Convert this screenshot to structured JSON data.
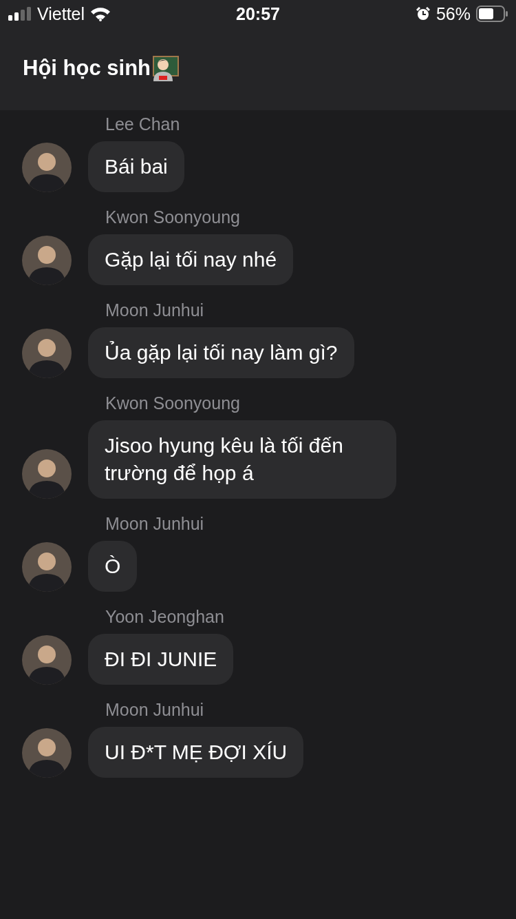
{
  "status_bar": {
    "carrier": "Viettel",
    "time": "20:57",
    "battery": "56%"
  },
  "header": {
    "title": "Hội học sinh"
  },
  "messages": [
    {
      "sender": "Lee Chan",
      "text": "Bái bai"
    },
    {
      "sender": "Kwon Soonyoung",
      "text": "Gặp lại tối nay nhé"
    },
    {
      "sender": "Moon Junhui",
      "text": "Ủa gặp lại tối nay làm gì?"
    },
    {
      "sender": "Kwon Soonyoung",
      "text": "Jisoo hyung kêu là tối đến trường để họp á"
    },
    {
      "sender": "Moon Junhui",
      "text": "Ò"
    },
    {
      "sender": "Yoon Jeonghan",
      "text": "ĐI ĐI JUNIE"
    },
    {
      "sender": "Moon Junhui",
      "text": "UI Đ*T MẸ ĐỢI XÍU"
    }
  ]
}
